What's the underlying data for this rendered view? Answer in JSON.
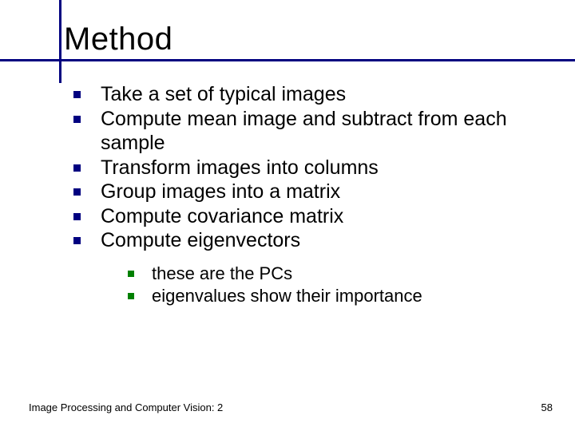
{
  "title": "Method",
  "bullets": [
    {
      "text": "Take a set of typical images"
    },
    {
      "text": "Compute mean image and subtract from each sample"
    },
    {
      "text": "Transform images into columns"
    },
    {
      "text": "Group images into a matrix"
    },
    {
      "text": "Compute covariance matrix"
    },
    {
      "text": "Compute eigenvectors",
      "sub": [
        {
          "text": "these are the PCs"
        },
        {
          "text": "eigenvalues show their importance"
        }
      ]
    }
  ],
  "footer": {
    "left": "Image Processing and Computer Vision: 2",
    "page": "58"
  },
  "colors": {
    "accent": "#000080",
    "accent2": "#008000"
  }
}
